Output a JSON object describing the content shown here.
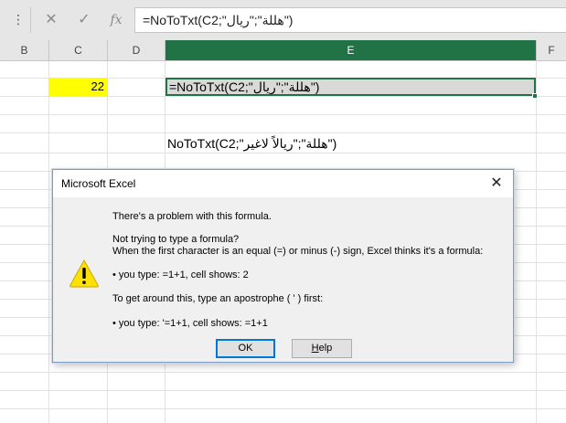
{
  "formula_bar": {
    "grip": "⋮",
    "cancel_icon": "✕",
    "enter_icon": "✓",
    "fx_label": "fx",
    "value": "=NoToTxt(C2;\"هللة\";\"ريال\")"
  },
  "columns": [
    {
      "label": "B"
    },
    {
      "label": "C"
    },
    {
      "label": "D"
    },
    {
      "label": "E"
    },
    {
      "label": "F"
    }
  ],
  "cells": {
    "c2": "22",
    "e2": "=NoToTxt(C2;\"هللة\";\"ريال\")",
    "e5": "NoToTxt(C2;\"هللة\";\"ريالاً لاغير\")"
  },
  "dialog": {
    "title": "Microsoft Excel",
    "close_icon": "✕",
    "icon": "warning-icon",
    "lines": [
      "There's a problem with this formula.",
      "Not trying to type a formula?",
      "When the first character is an equal (=) or minus (-) sign, Excel thinks it's a formula:",
      "• you type:   =1+1, cell shows:   2",
      "To get around this, type an apostrophe ( ' ) first:",
      "• you type:   '=1+1, cell shows:   =1+1"
    ],
    "ok_label": "OK",
    "help_label_underlined": "H",
    "help_label_rest": "elp"
  },
  "colors": {
    "header_active": "#217346",
    "highlight_yellow": "#ffff00",
    "warning_yellow": "#ffe100"
  }
}
